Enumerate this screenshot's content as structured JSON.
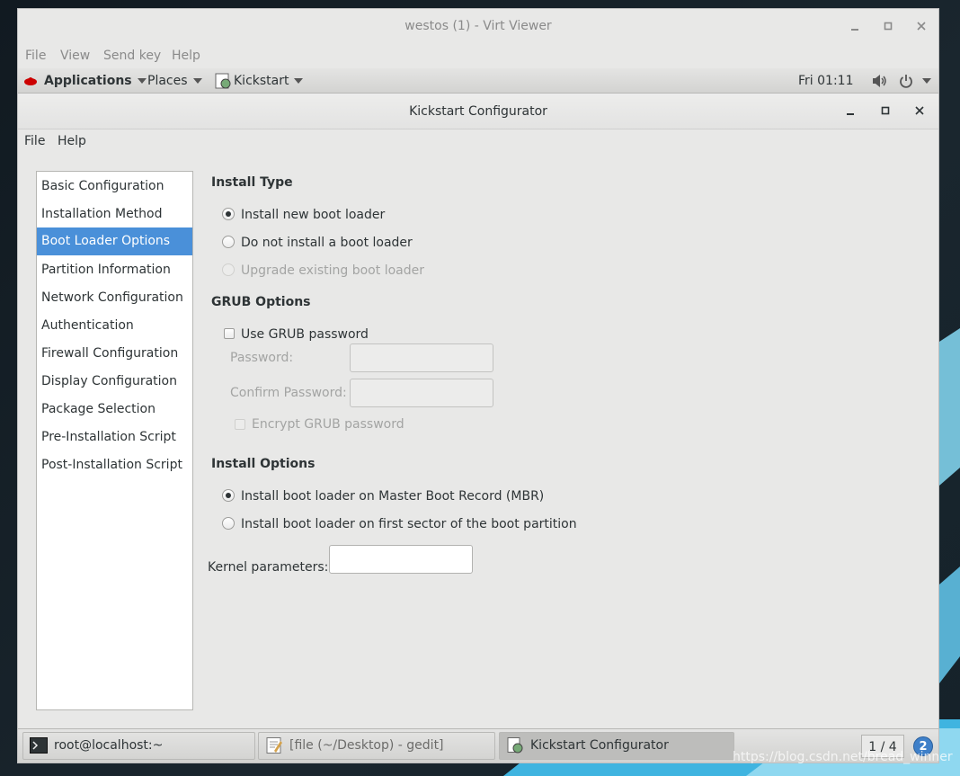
{
  "viewer": {
    "title": "westos (1) - Virt Viewer",
    "menu": [
      "File",
      "View",
      "Send key",
      "Help"
    ]
  },
  "top_panel": {
    "applications": "Applications",
    "places": "Places",
    "app_menu": "Kickstart",
    "clock": "Fri 01:11"
  },
  "app": {
    "title": "Kickstart Configurator",
    "menu": [
      "File",
      "Help"
    ],
    "sidebar": {
      "items": [
        "Basic Configuration",
        "Installation Method",
        "Boot Loader Options",
        "Partition Information",
        "Network Configuration",
        "Authentication",
        "Firewall Configuration",
        "Display Configuration",
        "Package Selection",
        "Pre-Installation Script",
        "Post-Installation Script"
      ],
      "selected": "Boot Loader Options"
    },
    "install_type": {
      "title": "Install Type",
      "options": [
        "Install new boot loader",
        "Do not install a boot loader",
        "Upgrade existing boot loader"
      ],
      "selected": "Install new boot loader",
      "disabled": [
        "Upgrade existing boot loader"
      ]
    },
    "grub": {
      "title": "GRUB Options",
      "use_password_label": "Use GRUB password",
      "use_password_checked": false,
      "password_label": "Password:",
      "password_value": "",
      "confirm_label": "Confirm Password:",
      "confirm_value": "",
      "encrypt_label": "Encrypt GRUB password",
      "encrypt_checked": false
    },
    "install_options": {
      "title": "Install Options",
      "options": [
        "Install boot loader on Master Boot Record (MBR)",
        "Install boot loader on first sector of the boot partition"
      ],
      "selected": "Install boot loader on Master Boot Record (MBR)"
    },
    "kernel": {
      "label": "Kernel parameters:",
      "value": ""
    }
  },
  "taskbar": {
    "tasks": [
      "root@localhost:~",
      "[file (~/Desktop) - gedit]",
      "Kickstart Configurator"
    ],
    "active_task": "Kickstart Configurator",
    "pager": "1 / 4",
    "notifications": "2"
  },
  "watermark": "https://blog.csdn.net/bread_winner",
  "colors": {
    "selection": "#4a90d9",
    "window_bg": "#e8e8e7",
    "notification": "#3f80c9"
  }
}
